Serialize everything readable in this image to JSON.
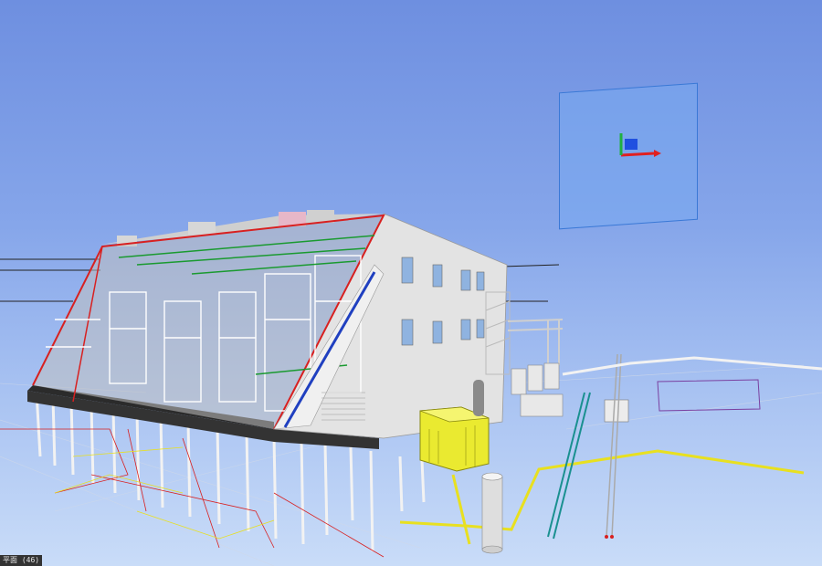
{
  "app": {
    "view": "3d-plant-model",
    "background_top": "#6e8fe0",
    "background_bottom": "#c9dcf8"
  },
  "gizmo": {
    "axis_colors": {
      "x": "#e02020",
      "y": "#20b040",
      "z": "#2050e0"
    },
    "plane_color": "#7fb0f0"
  },
  "status": {
    "text": "平面 (46)"
  },
  "colors": {
    "structure": "#e6e6e6",
    "steel_red": "#d82020",
    "pipe_green": "#1a9a30",
    "pipe_yellow": "#e8e020",
    "pipe_teal": "#1a9090",
    "pipe_blue": "#2040c0"
  }
}
